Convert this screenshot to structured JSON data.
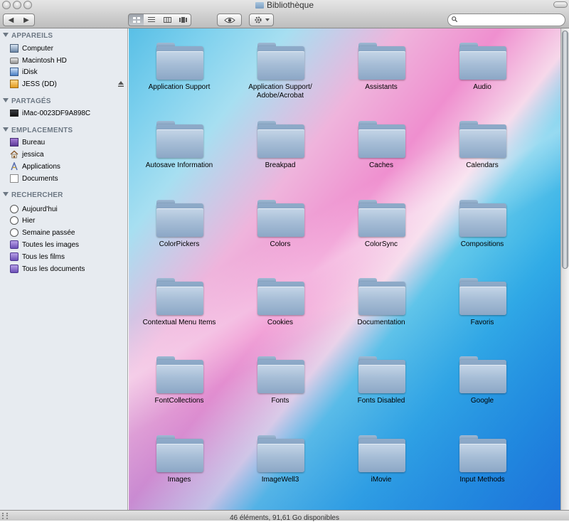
{
  "window": {
    "title": "Bibliothèque"
  },
  "toolbar": {
    "back_glyph": "◀",
    "forward_glyph": "▶",
    "view_modes": [
      "icon-view",
      "list-view",
      "column-view",
      "cover-flow-view"
    ],
    "quicklook_icon": "eye-icon",
    "action_icon": "gear-icon",
    "search": {
      "value": "",
      "placeholder": ""
    }
  },
  "sidebar": {
    "sections": [
      {
        "title": "APPAREILS",
        "items": [
          {
            "label": "Computer",
            "icon": "computer-icon"
          },
          {
            "label": "Macintosh HD",
            "icon": "hard-disk-icon"
          },
          {
            "label": "iDisk",
            "icon": "idisk-icon"
          },
          {
            "label": "JESS (DD)",
            "icon": "external-disk-icon"
          }
        ]
      },
      {
        "title": "PARTAGÉS",
        "items": [
          {
            "label": "iMac-0023DF9A898C",
            "icon": "imac-icon"
          }
        ]
      },
      {
        "title": "EMPLACEMENTS",
        "items": [
          {
            "label": "Bureau",
            "icon": "desktop-icon"
          },
          {
            "label": "jessica",
            "icon": "home-icon"
          },
          {
            "label": "Applications",
            "icon": "applications-icon"
          },
          {
            "label": "Documents",
            "icon": "documents-icon"
          }
        ]
      },
      {
        "title": "RECHERCHER",
        "items": [
          {
            "label": "Aujourd'hui",
            "icon": "clock-icon"
          },
          {
            "label": "Hier",
            "icon": "clock-icon"
          },
          {
            "label": "Semaine passée",
            "icon": "clock-icon"
          },
          {
            "label": "Toutes les images",
            "icon": "smart-folder-icon"
          },
          {
            "label": "Tous les films",
            "icon": "smart-folder-icon"
          },
          {
            "label": "Tous les documents",
            "icon": "smart-folder-icon"
          }
        ]
      }
    ]
  },
  "folders": [
    "Application Support",
    "Application Support/\nAdobe/Acrobat",
    "Assistants",
    "Audio",
    "Autosave Information",
    "Breakpad",
    "Caches",
    "Calendars",
    "ColorPickers",
    "Colors",
    "ColorSync",
    "Compositions",
    "Contextual Menu Items",
    "Cookies",
    "Documentation",
    "Favoris",
    "FontCollections",
    "Fonts",
    "Fonts Disabled",
    "Google",
    "Images",
    "ImageWell3",
    "iMovie",
    "Input Methods"
  ],
  "status": {
    "text": "46 éléments, 91,61 Go disponibles"
  }
}
